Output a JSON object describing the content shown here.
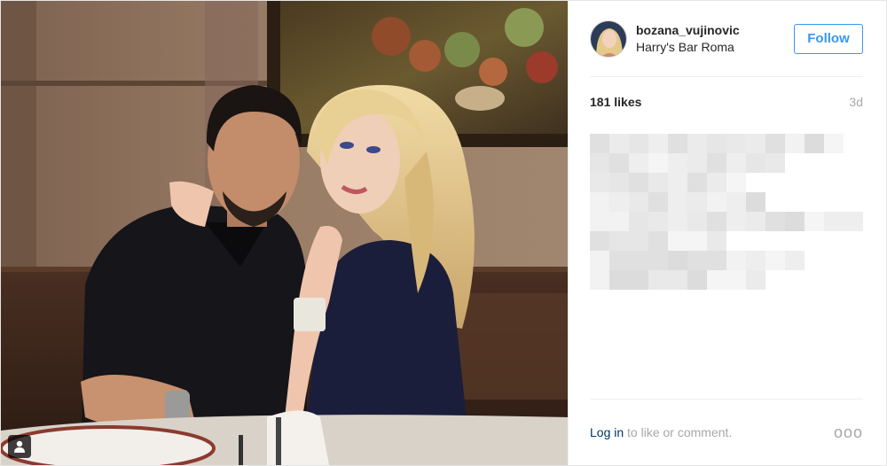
{
  "post": {
    "user": {
      "username": "bozana_vujinovic",
      "location": "Harry's Bar Roma",
      "follow_label": "Follow"
    },
    "likes": "181 likes",
    "timestamp": "3d",
    "caption": "",
    "footer": {
      "login_label": "Log in",
      "rest_label": " to like or comment.",
      "more_label": "ooo"
    }
  },
  "icons": {
    "tag": "user-tag-icon",
    "more": "more-options-icon"
  },
  "colors": {
    "accent": "#3897f0",
    "link": "#003569",
    "muted": "#a5a7aa"
  }
}
